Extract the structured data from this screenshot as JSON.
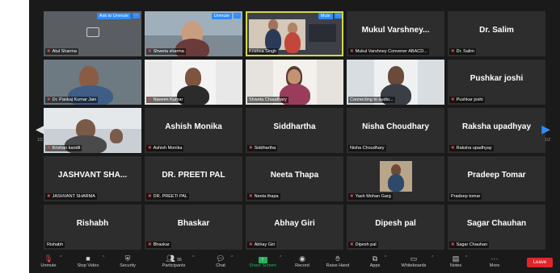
{
  "colors": {
    "accent": "#2d8cff",
    "active_outline": "#d4d84a",
    "leave": "#e0262b",
    "share": "#24b35c"
  },
  "tiles": [
    {
      "big": "",
      "label": "Atul Sharma"
    },
    {
      "big": "",
      "label": "Shweta sharma"
    },
    {
      "big": "",
      "label": "Krishna Singh"
    },
    {
      "big": "Mukul Varshney...",
      "label": "Mukul Varshney Convener ABACD..."
    },
    {
      "big": "Dr. Salim",
      "label": "Dr. Salim"
    },
    {
      "big": "",
      "label": "Dr. Pankaj Kumar Jain"
    },
    {
      "big": "",
      "label": "Naveen Kumar"
    },
    {
      "big": "",
      "label": "Shweta Chaudhary"
    },
    {
      "big": "",
      "label": "Connecting to audio..."
    },
    {
      "big": "Pushkar joshi",
      "label": "Pushkar joshi"
    },
    {
      "big": "",
      "label": "Krishan kandil"
    },
    {
      "big": "Ashish Monika",
      "label": "Ashish Monika"
    },
    {
      "big": "Siddhartha",
      "label": "Siddhartha"
    },
    {
      "big": "Nisha Choudhary",
      "label": "Nisha Choudhary"
    },
    {
      "big": "Raksha upadhyay",
      "label": "Raksha upadhyay"
    },
    {
      "big": "JASHVANT SHA...",
      "label": "JASHVANT SHARMA"
    },
    {
      "big": "DR. PREETI PAL",
      "label": "DR. PREETI PAL"
    },
    {
      "big": "Neeta Thapa",
      "label": "Neeta thapa"
    },
    {
      "big": "",
      "label": "Yash Mohan Garg"
    },
    {
      "big": "Pradeep Tomar",
      "label": "Pradeep tomar"
    },
    {
      "big": "Rishabh",
      "label": "Rishabh"
    },
    {
      "big": "Bhaskar",
      "label": "Bhaskar"
    },
    {
      "big": "Abhay Giri",
      "label": "Abhay Giri"
    },
    {
      "big": "Dipesh pal",
      "label": "Dipesh pal"
    },
    {
      "big": "Sagar Chauhan",
      "label": "Sagar Chauhan"
    }
  ],
  "tile_buttons": {
    "ask_unmute": "Ask to Unmute",
    "unmute": "Unmute",
    "mute": "Mute",
    "more": "···"
  },
  "pagination": {
    "left": "1/2",
    "right": "1/2"
  },
  "toolbar": {
    "unmute": "Unmute",
    "stop_video": "Stop Video",
    "security": "Security",
    "participants": "Participants",
    "participants_count": "55",
    "chat": "Chat",
    "share_screen": "Share Screen",
    "record": "Record",
    "raise_hand": "Raise Hand",
    "apps": "Apps",
    "whiteboards": "Whiteboards",
    "notes": "Notes",
    "more": "More",
    "leave": "Leave"
  }
}
